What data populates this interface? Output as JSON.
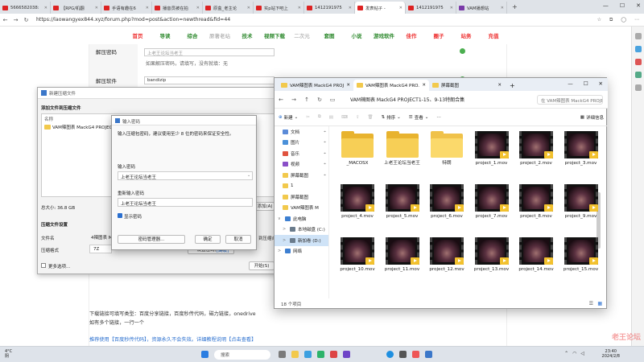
{
  "browser": {
    "tabs": [
      {
        "label": "5666582038:",
        "icon": "red"
      },
      {
        "label": "【RPG/机翻",
        "icon": "red"
      },
      {
        "label": "手语有趣在6",
        "icon": "red"
      },
      {
        "label": "播音员被在拍",
        "icon": "red"
      },
      {
        "label": "原盒_老主论",
        "icon": "red"
      },
      {
        "label": "实p站下吧上",
        "icon": "red"
      },
      {
        "label": "1412191975",
        "icon": "red"
      },
      {
        "label": "发表帖子 -",
        "icon": "red",
        "active": true
      },
      {
        "label": "1412191975",
        "icon": "red"
      },
      {
        "label": "VAM播想站",
        "icon": "hex"
      }
    ],
    "url": "https://laowangyex844.xyz/forum.php?mod=post&action=newthread&fid=44",
    "window_controls": [
      "—",
      "☐",
      "✕"
    ]
  },
  "forum": {
    "nav": [
      {
        "label": "首页",
        "style": "sel"
      },
      {
        "label": "导读",
        "style": ""
      },
      {
        "label": "综合",
        "style": ""
      },
      {
        "label": "原著老站",
        "style": "gray"
      },
      {
        "label": "技术",
        "style": ""
      },
      {
        "label": "视频下载",
        "style": ""
      },
      {
        "label": "二次元",
        "style": "gray"
      },
      {
        "label": "套图",
        "style": ""
      },
      {
        "label": "小说",
        "style": ""
      },
      {
        "label": "游戏软件",
        "style": ""
      },
      {
        "label": "佳作",
        "style": "red"
      },
      {
        "label": "圈子",
        "style": "red"
      },
      {
        "label": "站务",
        "style": "red"
      },
      {
        "label": "充值",
        "style": "red"
      }
    ],
    "unzip_pwd_label": "解压密码",
    "unzip_pwd_placeholder": "上老王论坛当老王",
    "unzip_pwd_hint": "如果解压密码，请填写，没有就填：无",
    "unzip_sw_label": "解压软件",
    "unzip_sw_value": "bandizip",
    "download_hint": "下载链接可填写类型：百度分享链接，百度秒传代码，磁力链接，onedrive",
    "multi_links_hint": "如有多个链接，一行一个",
    "recommend_text": "推荐使用【百度秒传代码】，资源永久不会失效。详细教程说明【点击查看】"
  },
  "rar": {
    "title": "新建压缩文件",
    "add_label": "添加文件到压缩文件",
    "col_name": "名称",
    "file_name": "VAM辣图表 MackG4 PROJEC",
    "total_size": "总大小: 36.8 GB",
    "settings_label": "压缩文件设置",
    "filename_label": "文件名",
    "filename_value": "4辣图表 MackG",
    "format_label": "压缩格式",
    "format_value": "7Z",
    "add_btn": "添加(A)",
    "merge_label": "到压缩合",
    "setting_pwd_btn": "设置密码(P)...",
    "advanced_btn": "[高级]",
    "more_options": "更多选项...",
    "start_btn": "开始(S)"
  },
  "pwd": {
    "title": "输入密码",
    "hint": "输入压缩包密码，建议使用至少 8 位的密码来保证安全性。",
    "enter_label": "输入密码",
    "enter_value": "上老王论坛当老王",
    "reenter_label": "重新输入密码",
    "reenter_value": "上老王论坛当老王",
    "show_pwd": "显示密码",
    "manage_btn": "密码管理器...",
    "ok_btn": "确定",
    "cancel_btn": "取消"
  },
  "explorer": {
    "tabs": [
      {
        "label": "VAM辣图表 MackG4 PROJ"
      },
      {
        "label": "VAM辣图表 MackG4 PRO.",
        "active": true
      },
      {
        "label": "屏幕截图"
      }
    ],
    "breadcrumb": "VAM辣图表 MackG4 PROJECT1-15、9-13特朗合集",
    "search_placeholder": "在 VAM辣图表 MackG4 PROJE",
    "toolbar": {
      "new": "新建",
      "sort": "排序",
      "view": "查看",
      "details": "详细信息"
    },
    "nav": [
      {
        "label": "文档",
        "color": "#5b8bd8",
        "pinned": true
      },
      {
        "label": "图片",
        "color": "#4a90d9",
        "pinned": true
      },
      {
        "label": "音乐",
        "color": "#e0533f",
        "pinned": true
      },
      {
        "label": "视频",
        "color": "#8a4fc8",
        "pinned": true
      },
      {
        "label": "屏幕截图",
        "color": "#f2c94c",
        "pinned": true
      },
      {
        "label": "1",
        "color": "#f2c94c"
      },
      {
        "label": "屏幕截图",
        "color": "#f2c94c"
      },
      {
        "label": "VAM辣图表 M",
        "color": "#f2c94c"
      },
      {
        "label": "此电脑",
        "color": "#3d7fd1",
        "expand": "∨",
        "sub": true
      },
      {
        "label": "本地磁盘 (C:)",
        "color": "#6a7b8c",
        "expand": ">"
      },
      {
        "label": "新加卷 (D:)",
        "color": "#6a7b8c",
        "expand": ">",
        "selected": true
      },
      {
        "label": "网络",
        "color": "#3d7fd1",
        "expand": ">",
        "sub": true
      }
    ],
    "items": [
      {
        "name": "_MACOSX",
        "kind": "folder"
      },
      {
        "name": "上老王论坛当老王",
        "kind": "folder"
      },
      {
        "name": "特朗",
        "kind": "folder-light"
      },
      {
        "name": "project_1.mov",
        "kind": "video"
      },
      {
        "name": "project_2.mov",
        "kind": "video"
      },
      {
        "name": "project_3.mov",
        "kind": "video"
      },
      {
        "name": "project_4.mov",
        "kind": "video"
      },
      {
        "name": "project_5.mov",
        "kind": "video"
      },
      {
        "name": "project_6.mov",
        "kind": "video"
      },
      {
        "name": "project_7.mov",
        "kind": "video"
      },
      {
        "name": "project_8.mov",
        "kind": "video"
      },
      {
        "name": "project_9.mov",
        "kind": "video"
      },
      {
        "name": "project_10.mov",
        "kind": "video"
      },
      {
        "name": "project_11.mov",
        "kind": "video"
      },
      {
        "name": "project_12.mov",
        "kind": "video"
      },
      {
        "name": "project_13.mov",
        "kind": "video"
      },
      {
        "name": "project_14.mov",
        "kind": "video"
      },
      {
        "name": "project_15.mov",
        "kind": "video"
      }
    ],
    "status": "18 个项目"
  },
  "taskbar": {
    "temp": "4°C",
    "weather": "阴",
    "search": "搜索",
    "time": "23:40",
    "date": "2024/2/8"
  },
  "watermark": "老王论坛"
}
